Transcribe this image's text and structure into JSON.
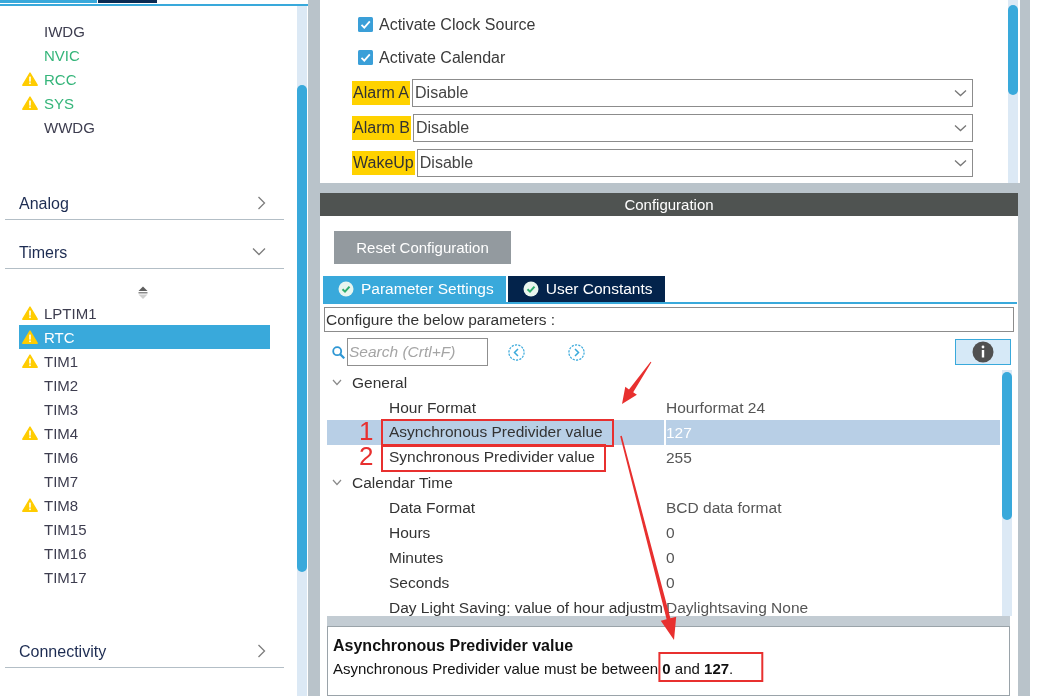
{
  "sidebar": {
    "items": [
      {
        "label": "IWDG",
        "enabled": false,
        "warning": false,
        "selected": false
      },
      {
        "label": "NVIC",
        "enabled": true,
        "warning": false,
        "selected": false
      },
      {
        "label": "RCC",
        "enabled": true,
        "warning": true,
        "selected": false
      },
      {
        "label": "SYS",
        "enabled": true,
        "warning": true,
        "selected": false
      },
      {
        "label": "WWDG",
        "enabled": false,
        "warning": false,
        "selected": false
      }
    ],
    "categories": [
      {
        "label": "Analog",
        "expanded": false
      },
      {
        "label": "Timers",
        "expanded": true,
        "items": [
          {
            "label": "LPTIM1",
            "enabled": false,
            "warning": true,
            "selected": false
          },
          {
            "label": "RTC",
            "enabled": false,
            "warning": true,
            "selected": true
          },
          {
            "label": "TIM1",
            "enabled": false,
            "warning": true,
            "selected": false
          },
          {
            "label": "TIM2",
            "enabled": false,
            "warning": false,
            "selected": false
          },
          {
            "label": "TIM3",
            "enabled": false,
            "warning": false,
            "selected": false
          },
          {
            "label": "TIM4",
            "enabled": false,
            "warning": true,
            "selected": false
          },
          {
            "label": "TIM6",
            "enabled": false,
            "warning": false,
            "selected": false
          },
          {
            "label": "TIM7",
            "enabled": false,
            "warning": false,
            "selected": false
          },
          {
            "label": "TIM8",
            "enabled": false,
            "warning": true,
            "selected": false
          },
          {
            "label": "TIM15",
            "enabled": false,
            "warning": false,
            "selected": false
          },
          {
            "label": "TIM16",
            "enabled": false,
            "warning": false,
            "selected": false
          },
          {
            "label": "TIM17",
            "enabled": false,
            "warning": false,
            "selected": false
          }
        ]
      },
      {
        "label": "Connectivity",
        "expanded": false
      }
    ]
  },
  "mode": {
    "checkboxes": [
      {
        "label": "Activate Clock Source",
        "checked": true
      },
      {
        "label": "Activate Calendar",
        "checked": true
      }
    ],
    "dropdowns": [
      {
        "label": "Alarm A",
        "value": "Disable"
      },
      {
        "label": "Alarm B",
        "value": "Disable"
      },
      {
        "label": "WakeUp",
        "value": "Disable"
      }
    ]
  },
  "configuration": {
    "title": "Configuration",
    "reset_button": "Reset Configuration",
    "tabs": [
      {
        "label": "Parameter Settings",
        "selected": true
      },
      {
        "label": "User Constants",
        "selected": false
      }
    ],
    "instructions": "Configure the below parameters :",
    "search": {
      "placeholder": "Search (Crtl+F)"
    },
    "parameters": [
      {
        "label": "General",
        "expanded": true,
        "selected": false,
        "children": [
          {
            "name": "Hour Format",
            "value": "Hourformat 24",
            "selected": false
          },
          {
            "name": "Asynchronous Predivider value",
            "value": "127",
            "selected": true,
            "marker": "1"
          },
          {
            "name": "Synchronous Predivider value",
            "value": "255",
            "selected": false,
            "marker": "2"
          }
        ]
      },
      {
        "label": "Calendar Time",
        "expanded": true,
        "selected": false,
        "children": [
          {
            "name": "Data Format",
            "value": "BCD data format",
            "selected": false
          },
          {
            "name": "Hours",
            "value": "0",
            "selected": false
          },
          {
            "name": "Minutes",
            "value": "0",
            "selected": false
          },
          {
            "name": "Seconds",
            "value": "0",
            "selected": false
          },
          {
            "name": "Day Light Saving: value of hour adjustm",
            "value": "Daylightsaving None",
            "selected": false
          }
        ]
      }
    ],
    "description": {
      "title": "Asynchronous Predivider value",
      "text": "Asynchronous Predivider value must be between **0** and **127**."
    }
  }
}
